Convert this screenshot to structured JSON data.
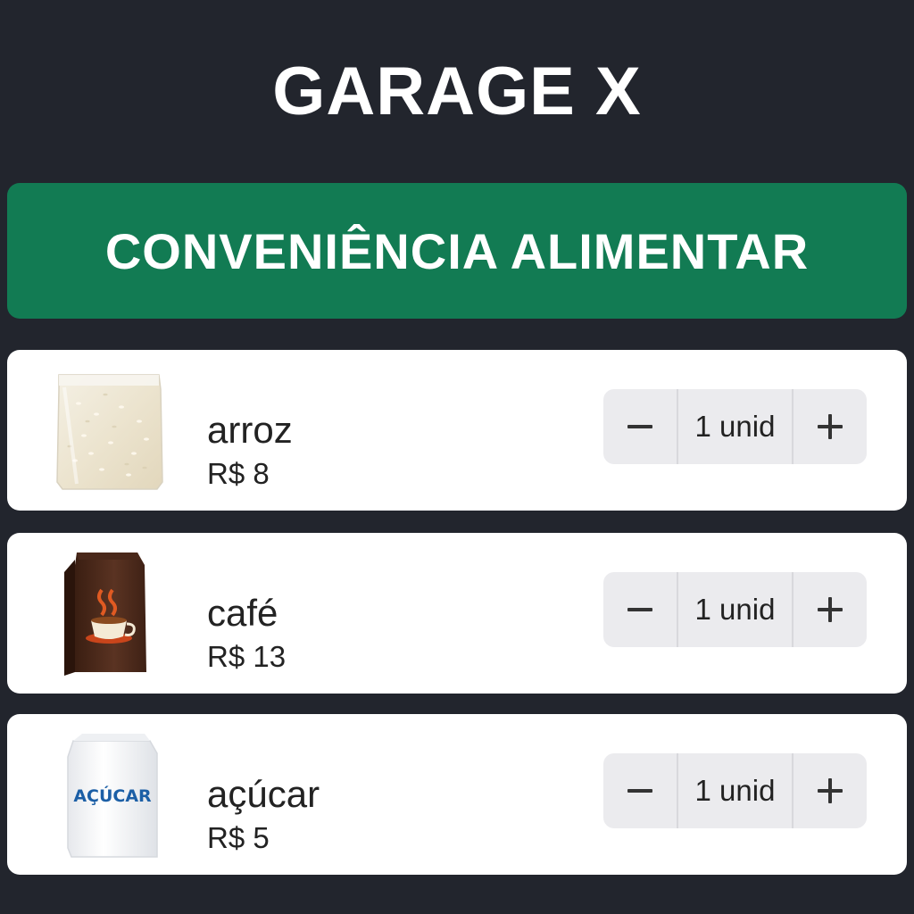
{
  "app": {
    "title": "GARAGE X"
  },
  "banner": {
    "label": "CONVENIÊNCIA ALIMENTAR",
    "color": "#127b53"
  },
  "icons": {
    "decrement": "minus-icon",
    "increment": "plus-icon"
  },
  "products": [
    {
      "name": "arroz",
      "price": "R$ 8",
      "quantity": "1 unid",
      "image": "rice-bag-image"
    },
    {
      "name": "café",
      "price": "R$ 13",
      "quantity": "1 unid",
      "image": "coffee-bag-image"
    },
    {
      "name": "açúcar",
      "price": "R$ 5",
      "quantity": "1 unid",
      "image": "sugar-bag-image",
      "package_label": "AÇÚCAR"
    }
  ]
}
